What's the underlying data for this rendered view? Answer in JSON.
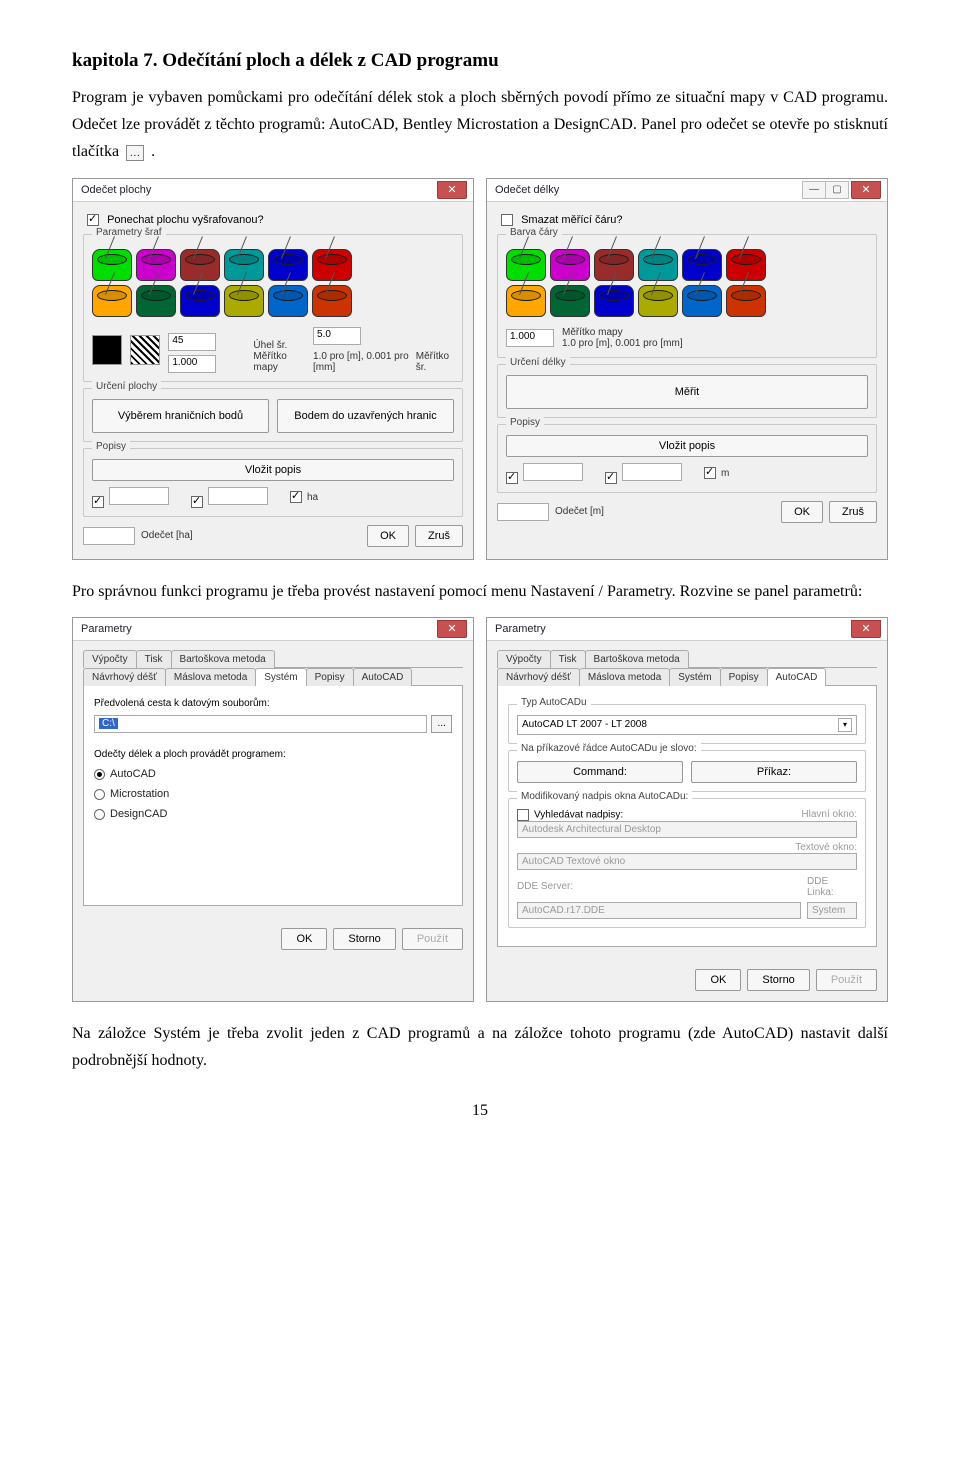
{
  "chapter": {
    "heading": "kapitola 7. Odečítání ploch a délek z CAD programu",
    "para1": "Program je vybaven pomůckami pro odečítání délek stok a ploch sběrných povodí přímo ze situační mapy v CAD programu. Odečet lze provádět z těchto programů: AutoCAD, Bentley Microstation a DesignCAD. Panel pro odečet se otevře po stisknutí tlačítka",
    "para1_end": ".",
    "para2": "Pro správnou funkci programu je třeba provést nastavení pomocí menu Nastavení / Parametry. Rozvine se panel parametrů:",
    "para3": "Na záložce Systém je třeba zvolit jeden z CAD programů a na záložce tohoto programu (zde AutoCAD) nastavit další podrobnější hodnoty."
  },
  "odecet_plochy": {
    "title": "Odečet plochy",
    "chk_ponechat": "Ponechat plochu vyšrafovanou?",
    "grp_sraf": "Parametry šraf",
    "uhel_val": "45",
    "uhel_lbl": "Úhel šr.",
    "mer_val": "5.0",
    "mer_lbl": "Měřítko šr.",
    "map_val": "1.000",
    "map_lbl": "Měřítko mapy",
    "map_lbl2": "1.0 pro [m], 0.001 pro [mm]",
    "grp_urceni": "Určení plochy",
    "btn_body": "Výběrem hraničních bodů",
    "btn_hranice": "Bodem do uzavřených hranic",
    "grp_popisy": "Popisy",
    "btn_popis": "Vložit popis",
    "chk_ha": "ha",
    "odecet_lbl": "Odečet [ha]",
    "ok": "OK",
    "zrus": "Zruš"
  },
  "odecet_delky": {
    "title": "Odečet délky",
    "chk_smazat": "Smazat měřící čáru?",
    "grp_barva": "Barva čáry",
    "map_val": "1.000",
    "map_lbl": "Měřítko mapy",
    "map_lbl2": "1.0 pro [m], 0.001 pro [mm]",
    "grp_urceni": "Určení délky",
    "btn_merit": "Měřit",
    "grp_popisy": "Popisy",
    "btn_popis": "Vložit popis",
    "chk_m": "m",
    "odecet_lbl": "Odečet [m]",
    "ok": "OK",
    "zrus": "Zruš"
  },
  "parametry": {
    "title": "Parametry",
    "tabs_top": [
      "Výpočty",
      "Tisk",
      "Bartoškova metoda"
    ],
    "tabs_bot": [
      "Návrhový déšť",
      "Máslova metoda",
      "Systém",
      "Popisy",
      "AutoCAD"
    ],
    "system": {
      "lbl_path": "Předvolená cesta k datovým souborům:",
      "path_val": "C:\\",
      "lbl_prog": "Odečty délek a ploch provádět programem:",
      "opts": [
        "AutoCAD",
        "Microstation",
        "DesignCAD"
      ]
    },
    "autocad": {
      "grp_typ": "Typ AutoCADu",
      "typ_val": "AutoCAD LT 2007 - LT 2008",
      "grp_cmd": "Na příkazové řádce AutoCADu je slovo:",
      "cmd1": "Command:",
      "cmd2": "Příkaz:",
      "grp_nadpis": "Modifikovaný nadpis okna AutoCADu:",
      "chk_vyhl": "Vyhledávat nadpisy:",
      "lbl_main": "Hlavní okno:",
      "val_main": "Autodesk Architectural Desktop",
      "lbl_text": "Textové okno:",
      "val_text": "AutoCAD Textové okno",
      "lbl_dde": "DDE Server:",
      "val_dde": "AutoCAD.r17.DDE",
      "lbl_link": "DDE Linka:",
      "val_link": "System"
    },
    "ok": "OK",
    "storno": "Storno",
    "pouzit": "Použít"
  },
  "page_number": "15"
}
